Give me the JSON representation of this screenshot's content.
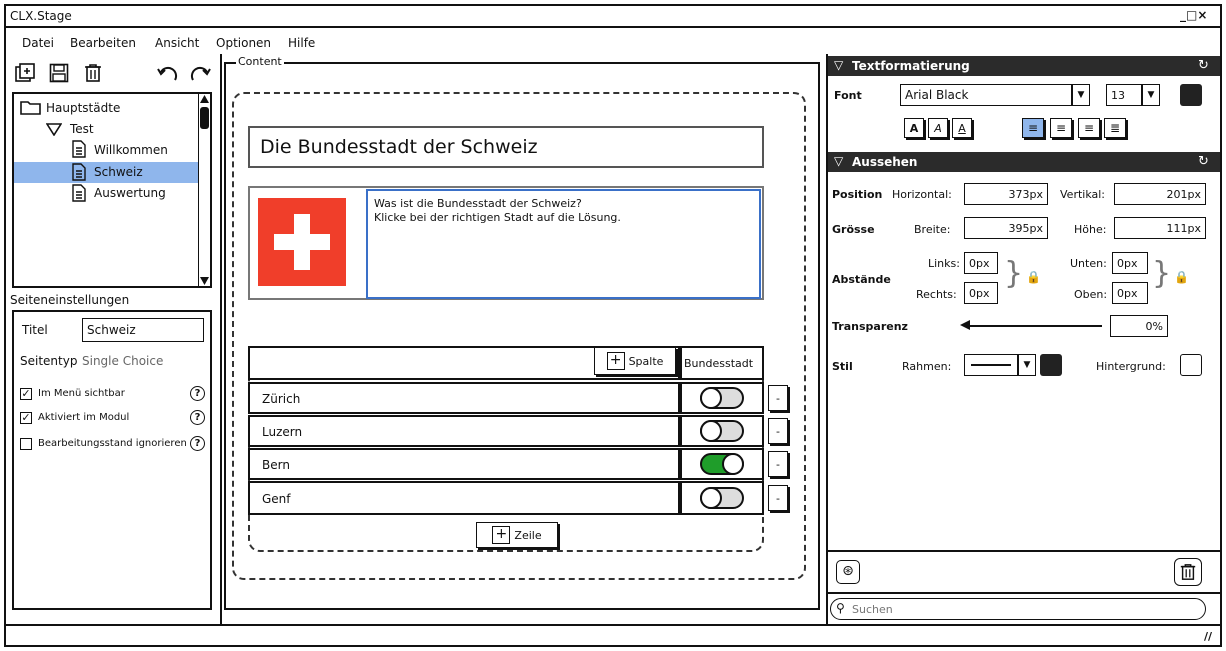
{
  "window": {
    "title": "CLX.Stage",
    "controls": "_□×"
  },
  "menu": [
    "Datei",
    "Bearbeiten",
    "Ansicht",
    "Optionen",
    "Hilfe"
  ],
  "tree": {
    "root": "Hauptstädte",
    "folder": "Test",
    "items": [
      "Willkommen",
      "Schweiz",
      "Auswertung"
    ],
    "selected": "Schweiz"
  },
  "page_settings": {
    "header": "Seiteneinstellungen",
    "title_label": "Titel",
    "title_value": "Schweiz",
    "type_label": "Seitentyp",
    "type_value": "Single Choice",
    "checkboxes": [
      {
        "label": "Im Menü sichtbar",
        "checked": true
      },
      {
        "label": "Aktiviert im Modul",
        "checked": true
      },
      {
        "label": "Bearbeitungsstand ignorieren",
        "checked": false
      }
    ]
  },
  "content": {
    "label": "Content",
    "heading": "Die Bundesstadt der Schweiz",
    "question_line1": "Was ist die Bundesstadt der Schweiz?",
    "question_line2": "Klicke bei der richtigen Stadt auf die Lösung.",
    "add_column": "Spalte",
    "column_header": "Bundesstadt",
    "rows": [
      {
        "label": "Zürich",
        "on": false
      },
      {
        "label": "Luzern",
        "on": false
      },
      {
        "label": "Bern",
        "on": true
      },
      {
        "label": "Genf",
        "on": false
      }
    ],
    "remove_label": "-",
    "add_row": "Zeile",
    "flag_color": "#f03e2a"
  },
  "text_format": {
    "header": "Textformatierung",
    "font_label": "Font",
    "font_value": "Arial Black",
    "size_value": "13",
    "style_buttons": [
      "A",
      "A",
      "A"
    ]
  },
  "appearance": {
    "header": "Aussehen",
    "position_label": "Position",
    "horizontal_label": "Horizontal:",
    "horizontal_value": "373px",
    "vertical_label": "Vertikal:",
    "vertical_value": "201px",
    "size_label": "Grösse",
    "width_label": "Breite:",
    "width_value": "395px",
    "height_label": "Höhe:",
    "height_value": "111px",
    "spacing_label": "Abstände",
    "left_label": "Links:",
    "left_value": "0px",
    "right_label": "Rechts:",
    "right_value": "0px",
    "bottom_label": "Unten:",
    "bottom_value": "0px",
    "top_label": "Oben:",
    "top_value": "0px",
    "transparency_label": "Transparenz",
    "transparency_value": "0%",
    "style_label": "Stil",
    "border_label": "Rahmen:",
    "background_label": "Hintergrund:"
  },
  "search": {
    "placeholder": "Suchen"
  },
  "colors": {
    "selection": "#8fb6ec",
    "panel_header": "#2b2b2b",
    "toggle_on": "#1f9d2a"
  }
}
